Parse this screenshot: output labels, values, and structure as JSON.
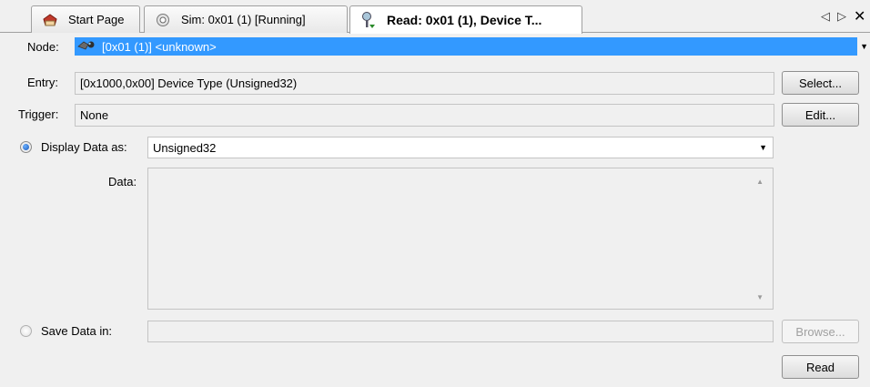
{
  "tabs": [
    {
      "label": "Start Page",
      "icon": "start-page-icon",
      "active": false
    },
    {
      "label": "Sim: 0x01 (1) [Running]",
      "icon": "sim-icon",
      "active": false
    },
    {
      "label": "Read: 0x01 (1), Device T...",
      "icon": "read-icon",
      "active": true
    }
  ],
  "tab_nav": {
    "prev": "◁",
    "next": "▷",
    "close": "✕"
  },
  "node": {
    "label": "Node:",
    "value": "[0x01 (1)] <unknown>"
  },
  "entry": {
    "label": "Entry:",
    "value": "[0x1000,0x00] Device Type (Unsigned32)",
    "button": "Select..."
  },
  "trigger": {
    "label": "Trigger:",
    "value": "None",
    "button": "Edit..."
  },
  "display": {
    "label": "Display Data as:",
    "value": "Unsigned32",
    "selected": true
  },
  "data": {
    "label": "Data:",
    "value": ""
  },
  "save": {
    "label": "Save Data in:",
    "value": "",
    "button": "Browse...",
    "selected": false
  },
  "read_button": "Read",
  "colors": {
    "selection": "#3399ff",
    "background": "#f0f0f0",
    "radio_dot": "#1a57b8"
  }
}
